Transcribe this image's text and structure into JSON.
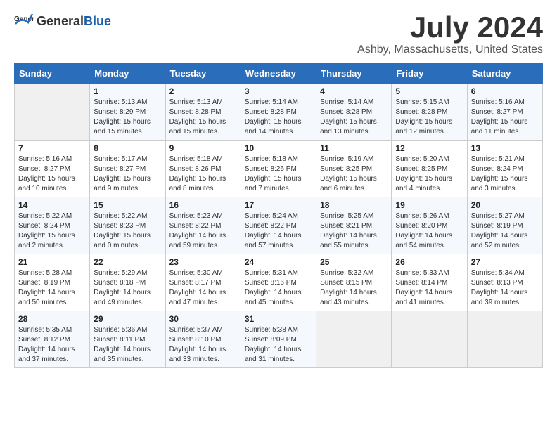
{
  "header": {
    "logo_general": "General",
    "logo_blue": "Blue",
    "title": "July 2024",
    "subtitle": "Ashby, Massachusetts, United States"
  },
  "calendar": {
    "days_of_week": [
      "Sunday",
      "Monday",
      "Tuesday",
      "Wednesday",
      "Thursday",
      "Friday",
      "Saturday"
    ],
    "weeks": [
      [
        {
          "day": "",
          "info": ""
        },
        {
          "day": "1",
          "info": "Sunrise: 5:13 AM\nSunset: 8:29 PM\nDaylight: 15 hours\nand 15 minutes."
        },
        {
          "day": "2",
          "info": "Sunrise: 5:13 AM\nSunset: 8:28 PM\nDaylight: 15 hours\nand 15 minutes."
        },
        {
          "day": "3",
          "info": "Sunrise: 5:14 AM\nSunset: 8:28 PM\nDaylight: 15 hours\nand 14 minutes."
        },
        {
          "day": "4",
          "info": "Sunrise: 5:14 AM\nSunset: 8:28 PM\nDaylight: 15 hours\nand 13 minutes."
        },
        {
          "day": "5",
          "info": "Sunrise: 5:15 AM\nSunset: 8:28 PM\nDaylight: 15 hours\nand 12 minutes."
        },
        {
          "day": "6",
          "info": "Sunrise: 5:16 AM\nSunset: 8:27 PM\nDaylight: 15 hours\nand 11 minutes."
        }
      ],
      [
        {
          "day": "7",
          "info": "Sunrise: 5:16 AM\nSunset: 8:27 PM\nDaylight: 15 hours\nand 10 minutes."
        },
        {
          "day": "8",
          "info": "Sunrise: 5:17 AM\nSunset: 8:27 PM\nDaylight: 15 hours\nand 9 minutes."
        },
        {
          "day": "9",
          "info": "Sunrise: 5:18 AM\nSunset: 8:26 PM\nDaylight: 15 hours\nand 8 minutes."
        },
        {
          "day": "10",
          "info": "Sunrise: 5:18 AM\nSunset: 8:26 PM\nDaylight: 15 hours\nand 7 minutes."
        },
        {
          "day": "11",
          "info": "Sunrise: 5:19 AM\nSunset: 8:25 PM\nDaylight: 15 hours\nand 6 minutes."
        },
        {
          "day": "12",
          "info": "Sunrise: 5:20 AM\nSunset: 8:25 PM\nDaylight: 15 hours\nand 4 minutes."
        },
        {
          "day": "13",
          "info": "Sunrise: 5:21 AM\nSunset: 8:24 PM\nDaylight: 15 hours\nand 3 minutes."
        }
      ],
      [
        {
          "day": "14",
          "info": "Sunrise: 5:22 AM\nSunset: 8:24 PM\nDaylight: 15 hours\nand 2 minutes."
        },
        {
          "day": "15",
          "info": "Sunrise: 5:22 AM\nSunset: 8:23 PM\nDaylight: 15 hours\nand 0 minutes."
        },
        {
          "day": "16",
          "info": "Sunrise: 5:23 AM\nSunset: 8:22 PM\nDaylight: 14 hours\nand 59 minutes."
        },
        {
          "day": "17",
          "info": "Sunrise: 5:24 AM\nSunset: 8:22 PM\nDaylight: 14 hours\nand 57 minutes."
        },
        {
          "day": "18",
          "info": "Sunrise: 5:25 AM\nSunset: 8:21 PM\nDaylight: 14 hours\nand 55 minutes."
        },
        {
          "day": "19",
          "info": "Sunrise: 5:26 AM\nSunset: 8:20 PM\nDaylight: 14 hours\nand 54 minutes."
        },
        {
          "day": "20",
          "info": "Sunrise: 5:27 AM\nSunset: 8:19 PM\nDaylight: 14 hours\nand 52 minutes."
        }
      ],
      [
        {
          "day": "21",
          "info": "Sunrise: 5:28 AM\nSunset: 8:19 PM\nDaylight: 14 hours\nand 50 minutes."
        },
        {
          "day": "22",
          "info": "Sunrise: 5:29 AM\nSunset: 8:18 PM\nDaylight: 14 hours\nand 49 minutes."
        },
        {
          "day": "23",
          "info": "Sunrise: 5:30 AM\nSunset: 8:17 PM\nDaylight: 14 hours\nand 47 minutes."
        },
        {
          "day": "24",
          "info": "Sunrise: 5:31 AM\nSunset: 8:16 PM\nDaylight: 14 hours\nand 45 minutes."
        },
        {
          "day": "25",
          "info": "Sunrise: 5:32 AM\nSunset: 8:15 PM\nDaylight: 14 hours\nand 43 minutes."
        },
        {
          "day": "26",
          "info": "Sunrise: 5:33 AM\nSunset: 8:14 PM\nDaylight: 14 hours\nand 41 minutes."
        },
        {
          "day": "27",
          "info": "Sunrise: 5:34 AM\nSunset: 8:13 PM\nDaylight: 14 hours\nand 39 minutes."
        }
      ],
      [
        {
          "day": "28",
          "info": "Sunrise: 5:35 AM\nSunset: 8:12 PM\nDaylight: 14 hours\nand 37 minutes."
        },
        {
          "day": "29",
          "info": "Sunrise: 5:36 AM\nSunset: 8:11 PM\nDaylight: 14 hours\nand 35 minutes."
        },
        {
          "day": "30",
          "info": "Sunrise: 5:37 AM\nSunset: 8:10 PM\nDaylight: 14 hours\nand 33 minutes."
        },
        {
          "day": "31",
          "info": "Sunrise: 5:38 AM\nSunset: 8:09 PM\nDaylight: 14 hours\nand 31 minutes."
        },
        {
          "day": "",
          "info": ""
        },
        {
          "day": "",
          "info": ""
        },
        {
          "day": "",
          "info": ""
        }
      ]
    ]
  }
}
